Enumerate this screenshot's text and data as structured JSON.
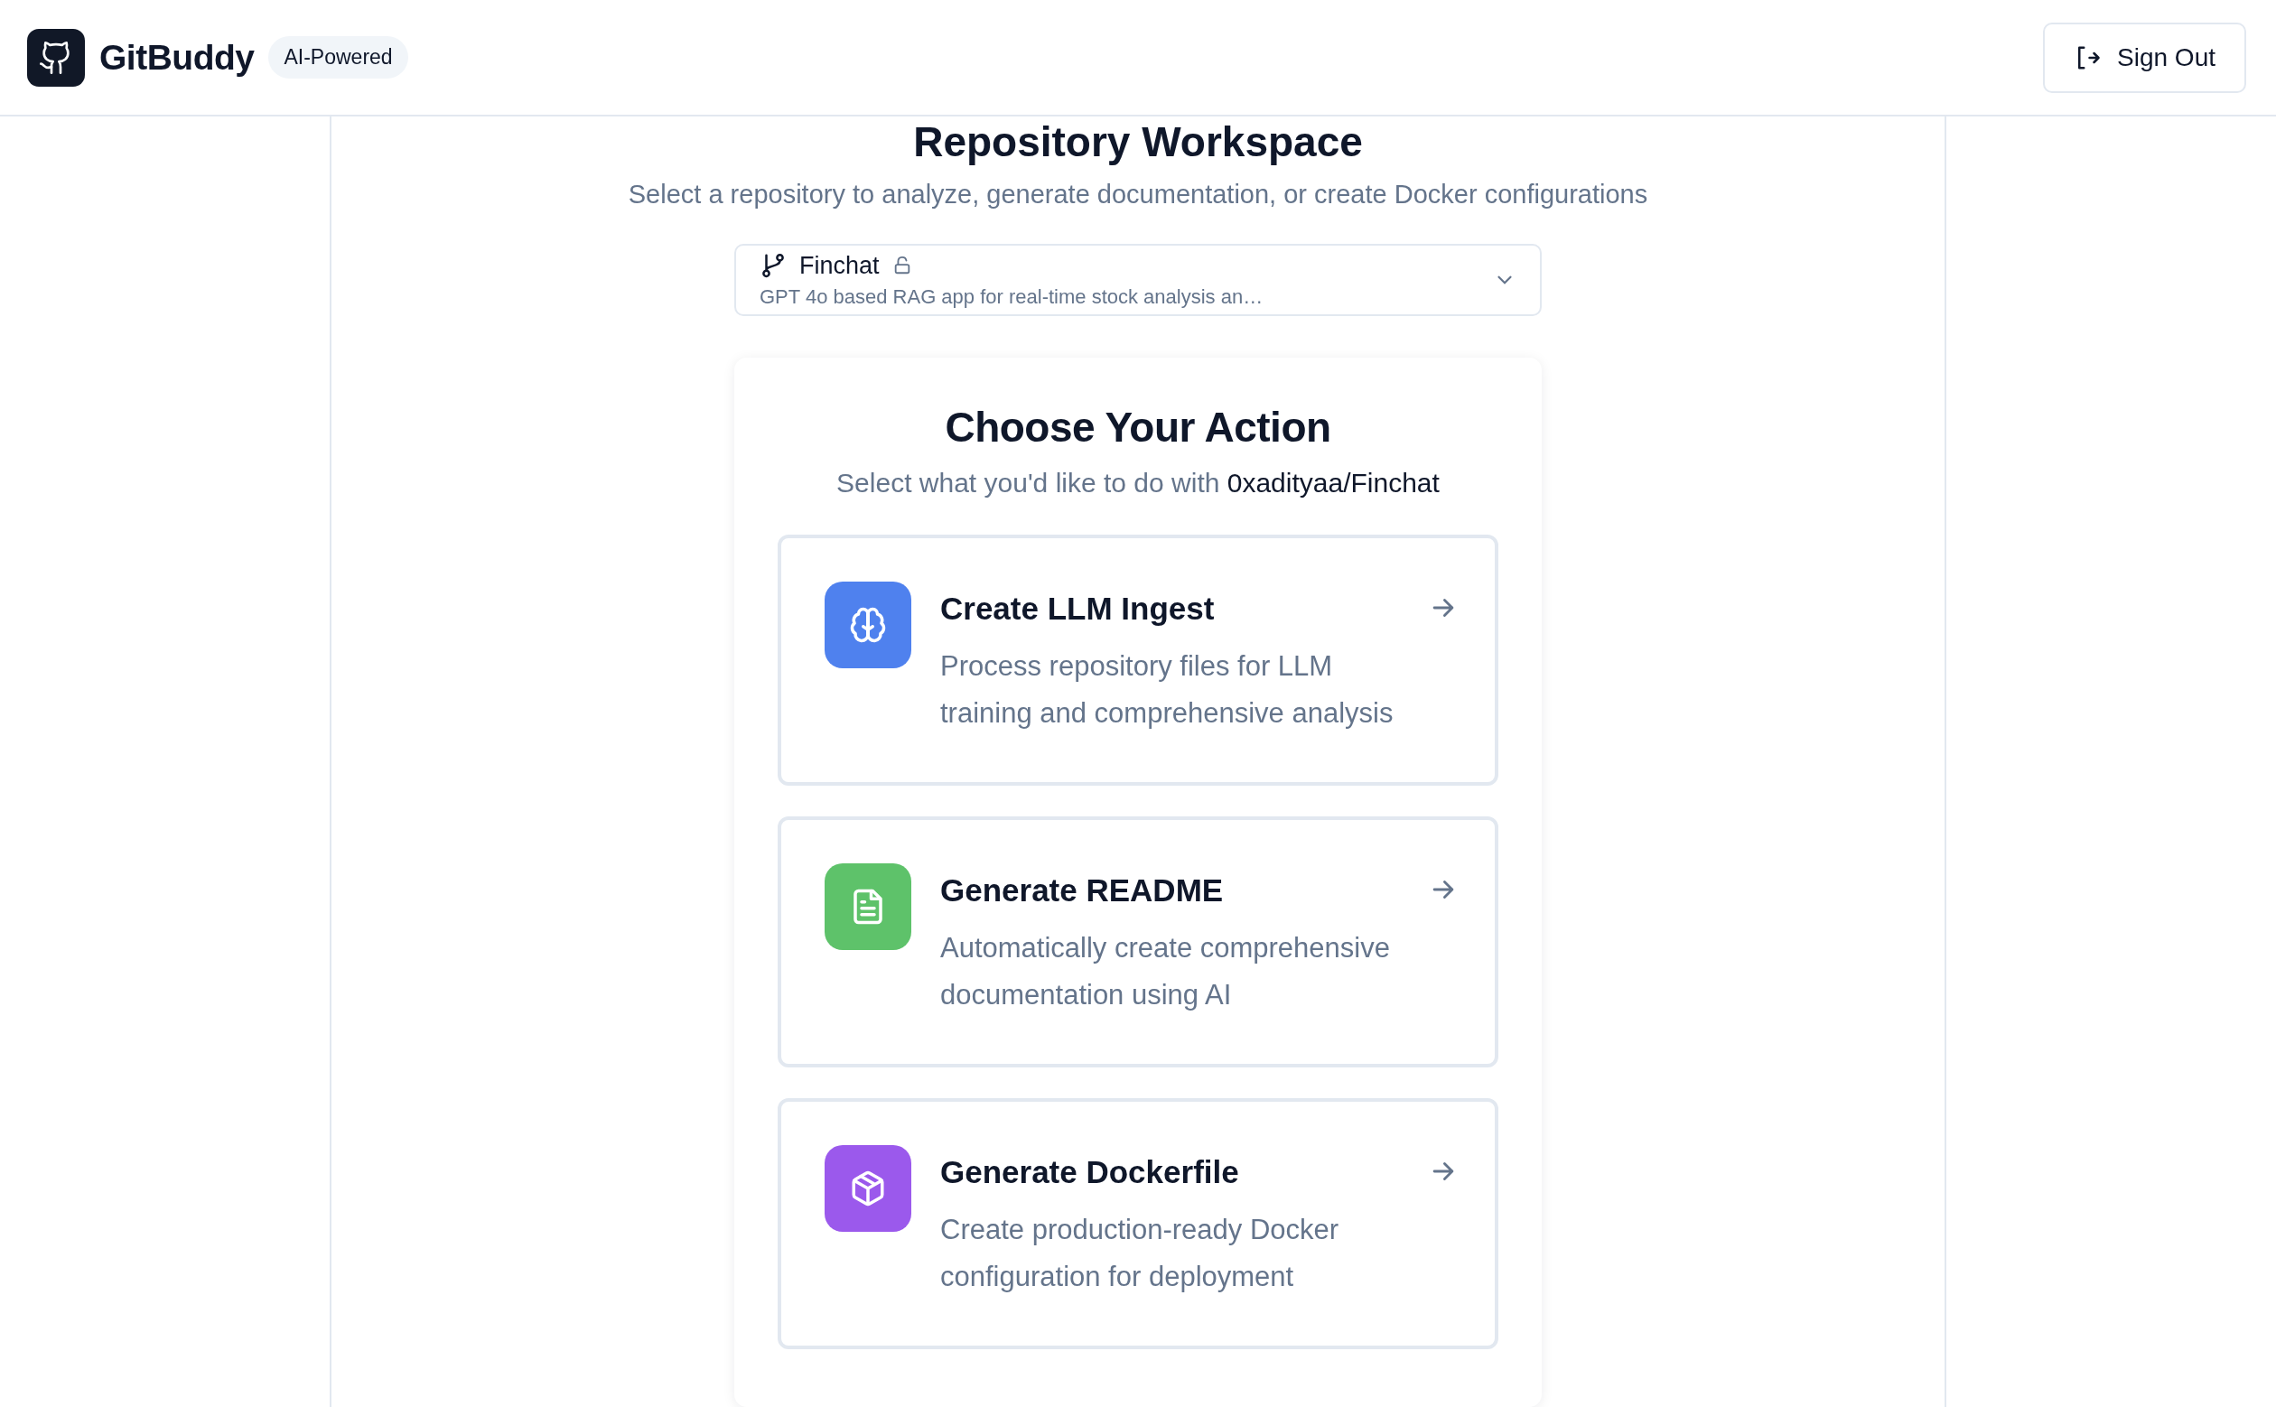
{
  "header": {
    "app_name": "GitBuddy",
    "badge": "AI-Powered",
    "sign_out": "Sign Out"
  },
  "workspace": {
    "title": "Repository Workspace",
    "subtitle": "Select a repository to analyze, generate documentation, or create Docker configurations"
  },
  "repo_select": {
    "name": "Finchat",
    "locked": false,
    "description": "GPT 4o based RAG app for real-time stock analysis an…"
  },
  "actions": {
    "title": "Choose Your Action",
    "subtitle": "Select what you'd like to do with **0xadityaa/Finchat**",
    "items": [
      {
        "kind": "brain",
        "title": "Create LLM Ingest",
        "description": "Process repository files for LLM training and comprehensive analysis",
        "color": "#4f81ee"
      },
      {
        "kind": "document",
        "title": "Generate README",
        "description": "Automatically create comprehensive documentation using AI",
        "color": "#5ec26a"
      },
      {
        "kind": "package",
        "title": "Generate Dockerfile",
        "description": "Create production-ready Docker configuration for deployment",
        "color": "#9b59ec"
      }
    ]
  }
}
